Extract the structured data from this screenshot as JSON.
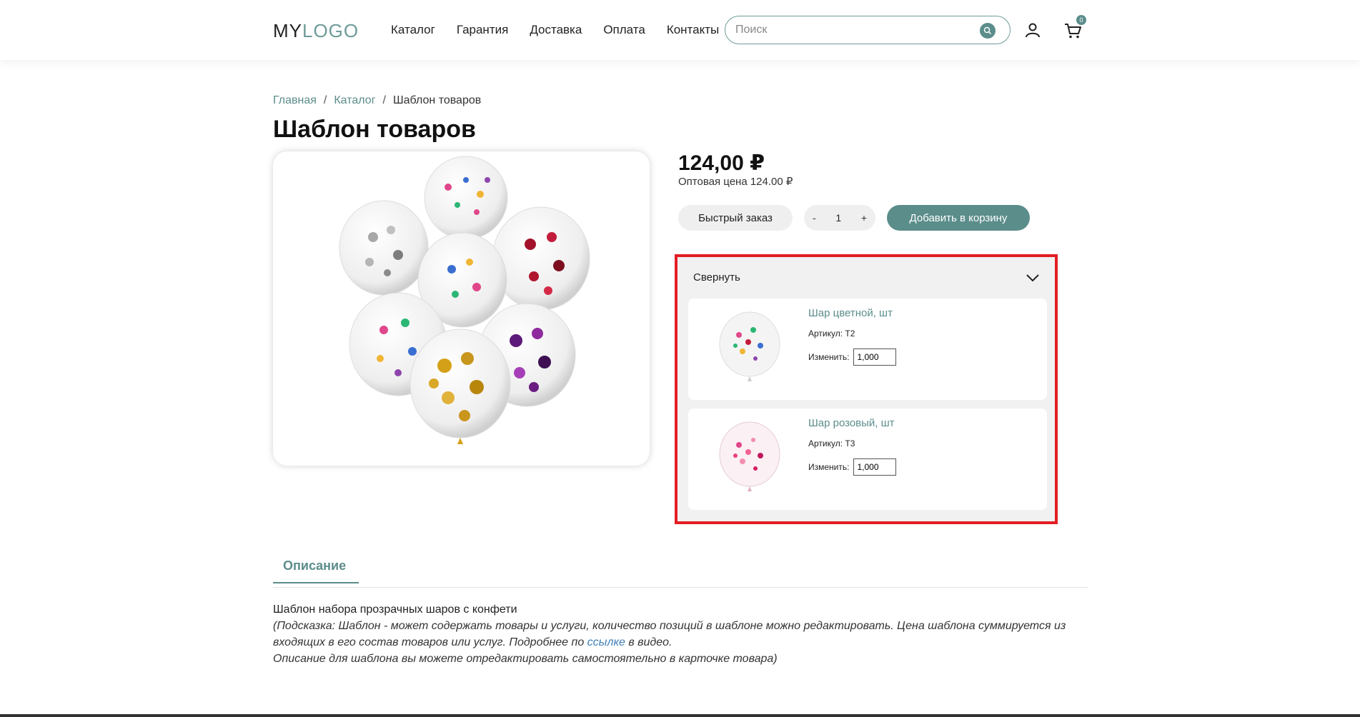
{
  "header": {
    "logo_my": "MY",
    "logo_rest": "LOGO",
    "nav": [
      "Каталог",
      "Гарантия",
      "Доставка",
      "Оплата",
      "Контакты"
    ],
    "search_placeholder": "Поиск",
    "cart_count": "0"
  },
  "breadcrumb": {
    "home": "Главная",
    "catalog": "Каталог",
    "current": "Шаблон товаров",
    "separator": "/"
  },
  "product": {
    "title": "Шаблон товаров",
    "price": "124,00 ₽",
    "wholesale": "Оптовая цена 124.00 ₽",
    "quick_order": "Быстрый заказ",
    "qty_minus": "-",
    "qty_value": "1",
    "qty_plus": "+",
    "add_to_cart": "Добавить в корзину"
  },
  "template_panel": {
    "toggle_label": "Свернуть",
    "items": [
      {
        "name": "Шар цветной, шт",
        "sku": "Артикул: T2",
        "change_label": "Изменить:",
        "qty": "1,000"
      },
      {
        "name": "Шар розовый, шт",
        "sku": "Артикул: T3",
        "change_label": "Изменить:",
        "qty": "1,000"
      }
    ]
  },
  "tabs": {
    "description": "Описание"
  },
  "description": {
    "line1": "Шаблон набора прозрачных шаров с конфети",
    "hint_part1": "(Подсказка: Шаблон - может содержать товары и услуги, количество позиций в шаблоне можно редактировать. Цена шаблона суммируется из входящих в его состав товаров или услуг. Подробнее по ",
    "hint_link": "ссылке",
    "hint_part2": " в видео.",
    "hint_line3": "Описание для шаблона вы можете отредактировать самостоятельно в карточке товара)"
  },
  "colors": {
    "accent": "#5b8d8b",
    "highlight_border": "#e31e24",
    "link": "#3f7fb6"
  }
}
